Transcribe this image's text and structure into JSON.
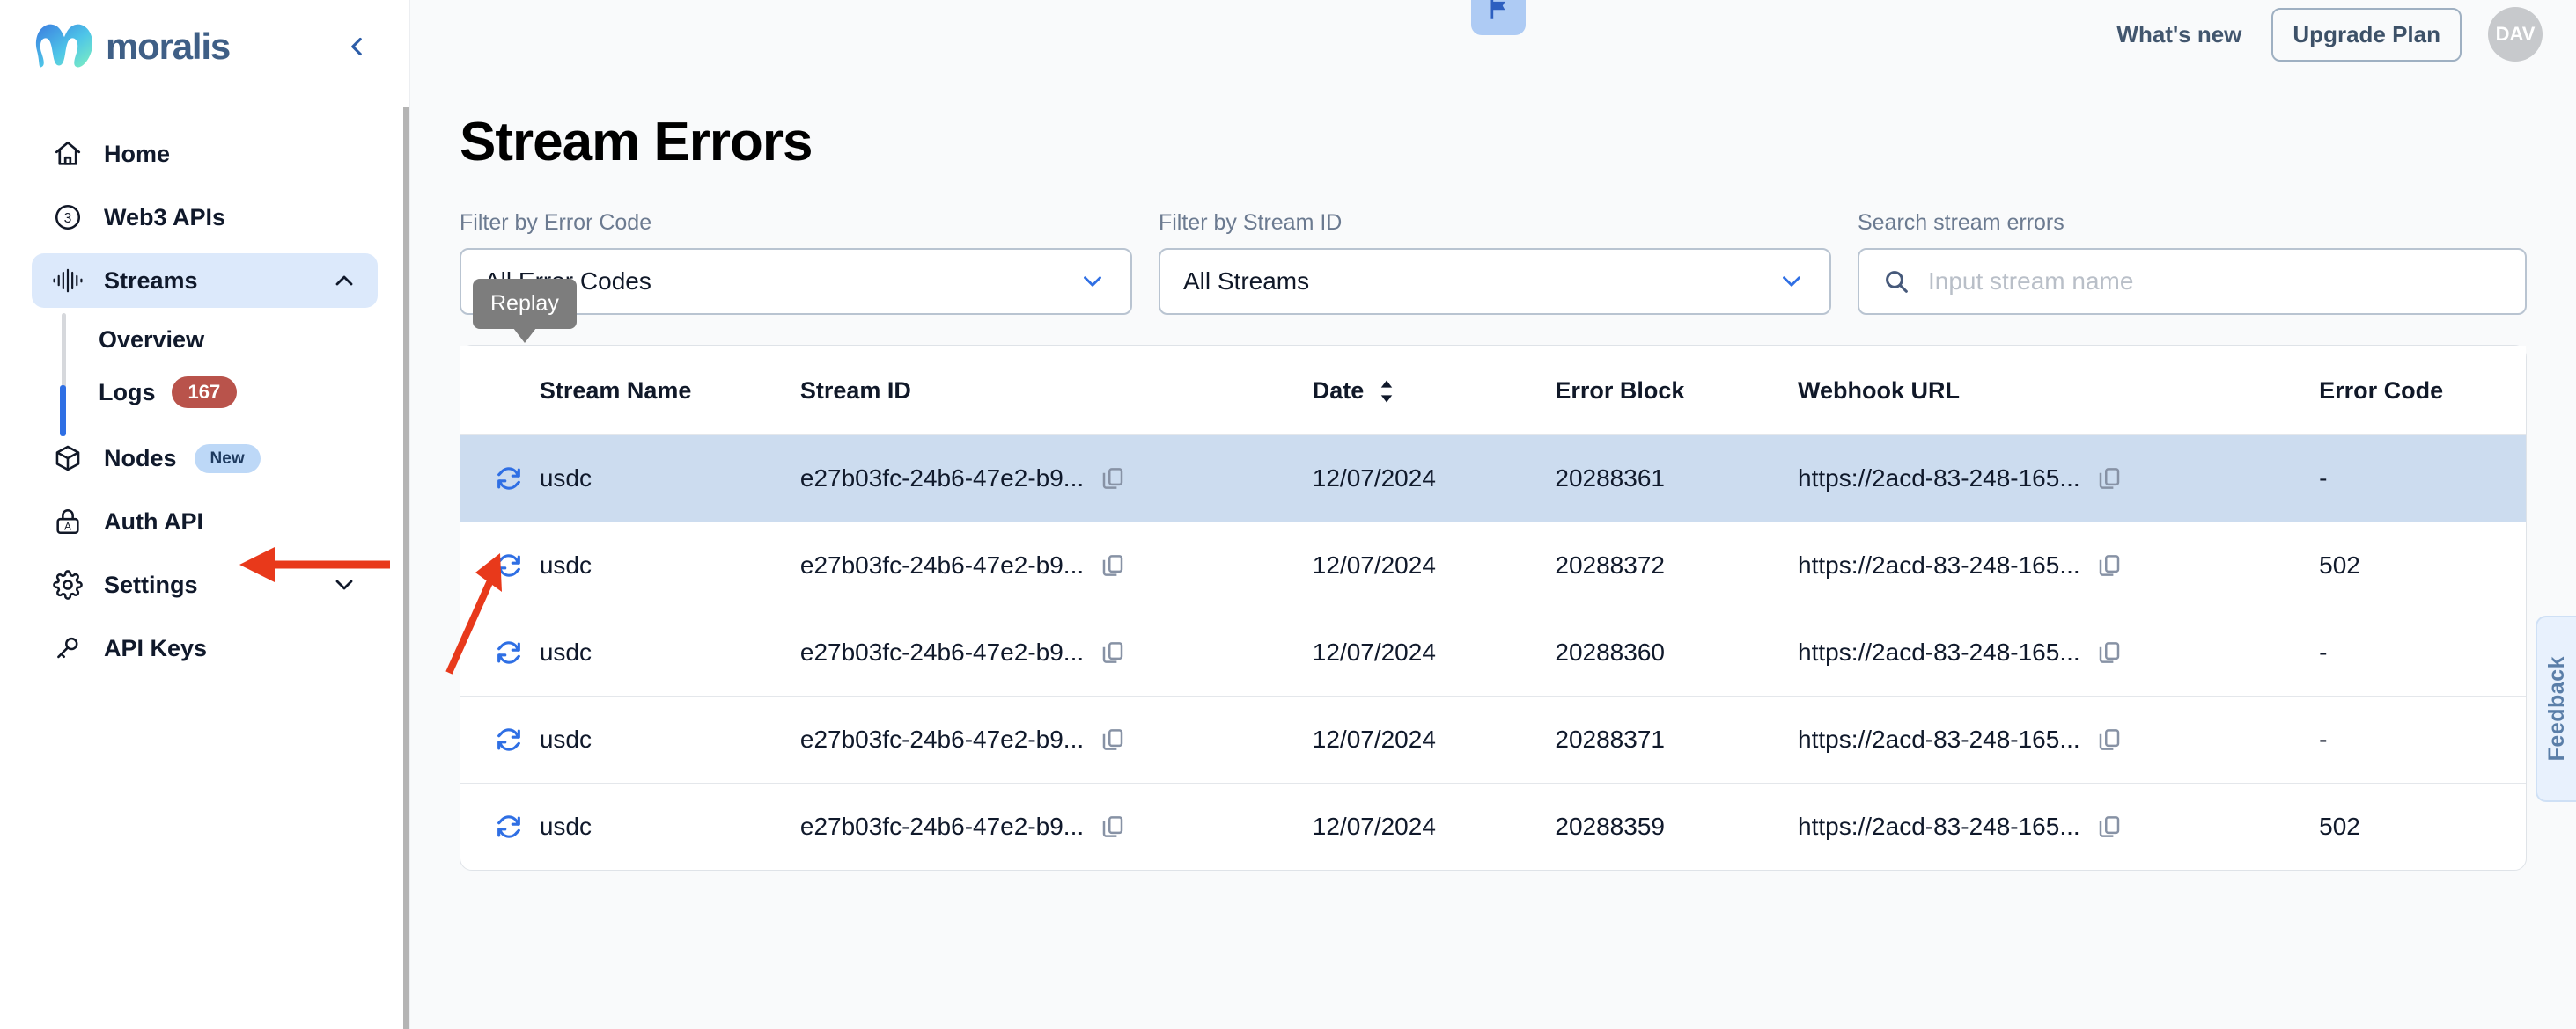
{
  "brand": {
    "name": "moralis",
    "collapse_icon": "chevron-left-icon"
  },
  "topbar": {
    "flag_icon": "flag-icon",
    "whats_new": "What's new",
    "upgrade": "Upgrade Plan",
    "avatar_initials": "DAV"
  },
  "sidebar": {
    "items": [
      {
        "label": "Home",
        "icon": "home-icon",
        "active": false
      },
      {
        "label": "Web3 APIs",
        "icon": "circle-three-icon",
        "active": false
      },
      {
        "label": "Streams",
        "icon": "waveform-icon",
        "active": true,
        "chevron": "chevron-up-icon"
      },
      {
        "label": "Nodes",
        "icon": "cube-icon",
        "active": false,
        "badge": "New"
      },
      {
        "label": "Auth API",
        "icon": "lock-a-icon",
        "active": false
      },
      {
        "label": "Settings",
        "icon": "gear-icon",
        "active": false,
        "chevron": "chevron-down-icon"
      },
      {
        "label": "API Keys",
        "icon": "key-icon",
        "active": false
      }
    ],
    "streams_sub": [
      {
        "label": "Overview",
        "active": false
      },
      {
        "label": "Logs",
        "active": true,
        "count": "167"
      }
    ]
  },
  "page": {
    "title": "Stream Errors"
  },
  "filters": {
    "error_code": {
      "label": "Filter by Error Code",
      "value": "All Error Codes",
      "chevron": "chevron-down-icon"
    },
    "stream_id": {
      "label": "Filter by Stream ID",
      "value": "All Streams",
      "chevron": "chevron-down-icon"
    },
    "search": {
      "label": "Search stream errors",
      "placeholder": "Input stream name",
      "value": "",
      "icon": "search-icon"
    }
  },
  "table": {
    "tooltip": "Replay",
    "columns": [
      "",
      "Stream Name",
      "Stream ID",
      "Date",
      "Error Block",
      "Webhook URL",
      "Error Code"
    ],
    "date_sort_icon": "sort-updown-icon",
    "rows": [
      {
        "replay_icon": "replay-icon",
        "stream_name": "usdc",
        "stream_id": "e27b03fc-24b6-47e2-b9...",
        "date": "12/07/2024",
        "error_block": "20288361",
        "webhook_url": "https://2acd-83-248-165...",
        "error_code": "-",
        "selected": true
      },
      {
        "replay_icon": "replay-icon",
        "stream_name": "usdc",
        "stream_id": "e27b03fc-24b6-47e2-b9...",
        "date": "12/07/2024",
        "error_block": "20288372",
        "webhook_url": "https://2acd-83-248-165...",
        "error_code": "502",
        "selected": false
      },
      {
        "replay_icon": "replay-icon",
        "stream_name": "usdc",
        "stream_id": "e27b03fc-24b6-47e2-b9...",
        "date": "12/07/2024",
        "error_block": "20288360",
        "webhook_url": "https://2acd-83-248-165...",
        "error_code": "-",
        "selected": false
      },
      {
        "replay_icon": "replay-icon",
        "stream_name": "usdc",
        "stream_id": "e27b03fc-24b6-47e2-b9...",
        "date": "12/07/2024",
        "error_block": "20288371",
        "webhook_url": "https://2acd-83-248-165...",
        "error_code": "-",
        "selected": false
      },
      {
        "replay_icon": "replay-icon",
        "stream_name": "usdc",
        "stream_id": "e27b03fc-24b6-47e2-b9...",
        "date": "12/07/2024",
        "error_block": "20288359",
        "webhook_url": "https://2acd-83-248-165...",
        "error_code": "502",
        "selected": false
      }
    ]
  },
  "feedback": {
    "label": "Feedback"
  },
  "annotations": {
    "arrow_color": "#e8391b"
  }
}
